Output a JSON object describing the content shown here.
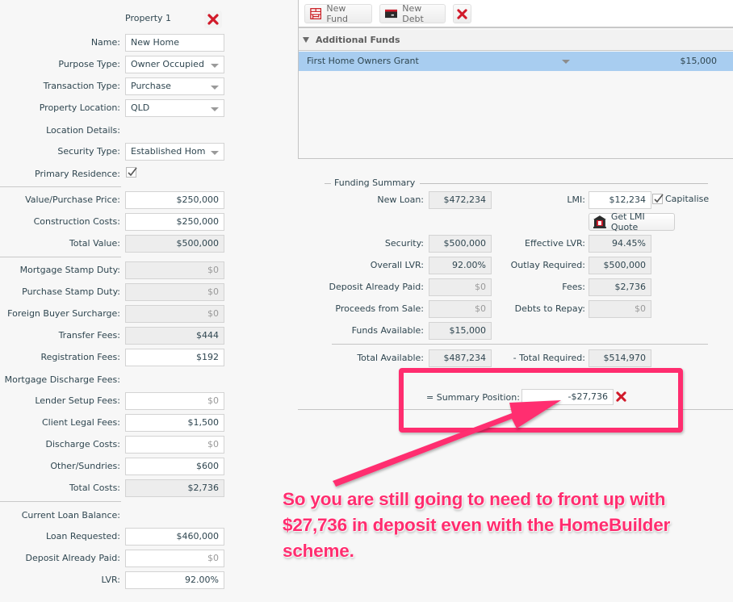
{
  "property": {
    "title": "Property 1",
    "fields": {
      "name": {
        "label": "Name:",
        "value": "New Home"
      },
      "purpose_type": {
        "label": "Purpose Type:",
        "value": "Owner Occupied"
      },
      "transaction_type": {
        "label": "Transaction Type:",
        "value": "Purchase"
      },
      "property_location": {
        "label": "Property Location:",
        "value": "QLD"
      },
      "location_details": {
        "label": "Location Details:"
      },
      "security_type": {
        "label": "Security Type:",
        "value": "Established Hom"
      },
      "primary_residence": {
        "label": "Primary Residence:",
        "checked": true
      },
      "value_purchase_price": {
        "label": "Value/Purchase Price:",
        "value": "$250,000"
      },
      "construction_costs": {
        "label": "Construction Costs:",
        "value": "$250,000"
      },
      "total_value": {
        "label": "Total Value:",
        "value": "$500,000"
      },
      "mortgage_stamp_duty": {
        "label": "Mortgage Stamp Duty:",
        "value": "$0"
      },
      "purchase_stamp_duty": {
        "label": "Purchase Stamp Duty:",
        "value": "$0"
      },
      "foreign_buyer_surcharge": {
        "label": "Foreign Buyer Surcharge:",
        "value": "$0"
      },
      "transfer_fees": {
        "label": "Transfer Fees:",
        "value": "$444"
      },
      "registration_fees": {
        "label": "Registration Fees:",
        "value": "$192"
      },
      "mortgage_discharge_fees": {
        "label": "Mortgage Discharge Fees:"
      },
      "lender_setup_fees": {
        "label": "Lender Setup Fees:",
        "value": "$0"
      },
      "client_legal_fees": {
        "label": "Client Legal Fees:",
        "value": "$1,500"
      },
      "discharge_costs": {
        "label": "Discharge Costs:",
        "value": "$0"
      },
      "other_sundries": {
        "label": "Other/Sundries:",
        "value": "$600"
      },
      "total_costs": {
        "label": "Total Costs:",
        "value": "$2,736"
      },
      "current_loan_balance": {
        "label": "Current Loan Balance:"
      },
      "loan_requested": {
        "label": "Loan Requested:",
        "value": "$460,000"
      },
      "deposit_already_paid": {
        "label": "Deposit Already Paid:",
        "value": "$0"
      },
      "lvr": {
        "label": "LVR:",
        "value": "92.00%"
      }
    }
  },
  "toolbar": {
    "new_fund": "New Fund",
    "new_debt": "New Debt"
  },
  "additional_funds": {
    "title": "Additional Funds",
    "rows": [
      {
        "name": "First Home Owners Grant",
        "amount": "$15,000"
      }
    ]
  },
  "funding_summary": {
    "title": "Funding Summary",
    "new_loan": {
      "label": "New Loan:",
      "value": "$472,234"
    },
    "lmi": {
      "label": "LMI:",
      "value": "$12,234"
    },
    "capitalise": {
      "label": "Capitalise",
      "checked": true
    },
    "get_lmi_quote": "Get LMI Quote",
    "security": {
      "label": "Security:",
      "value": "$500,000"
    },
    "effective_lvr": {
      "label": "Effective LVR:",
      "value": "94.45%"
    },
    "overall_lvr": {
      "label": "Overall LVR:",
      "value": "92.00%"
    },
    "outlay_required": {
      "label": "Outlay Required:",
      "value": "$500,000"
    },
    "deposit_already_paid": {
      "label": "Deposit Already Paid:",
      "value": "$0"
    },
    "fees": {
      "label": "Fees:",
      "value": "$2,736"
    },
    "proceeds_from_sale": {
      "label": "Proceeds from Sale:",
      "value": "$0"
    },
    "debts_to_repay": {
      "label": "Debts to Repay:",
      "value": "$0"
    },
    "funds_available": {
      "label": "Funds Available:",
      "value": "$15,000"
    },
    "total_available": {
      "label": "Total Available:",
      "value": "$487,234"
    },
    "total_required": {
      "label": "- Total Required:",
      "value": "$514,970"
    },
    "summary_position": {
      "label": "= Summary Position:",
      "value": "-$27,736"
    }
  },
  "annotation": {
    "text": "So you are still going to need to front up with $27,736 in deposit even with the HomeBuilder scheme.",
    "color": "#ff2d6f"
  },
  "colors": {
    "selected_row": "#a8cdf0",
    "delete_red": "#d11a2a"
  }
}
